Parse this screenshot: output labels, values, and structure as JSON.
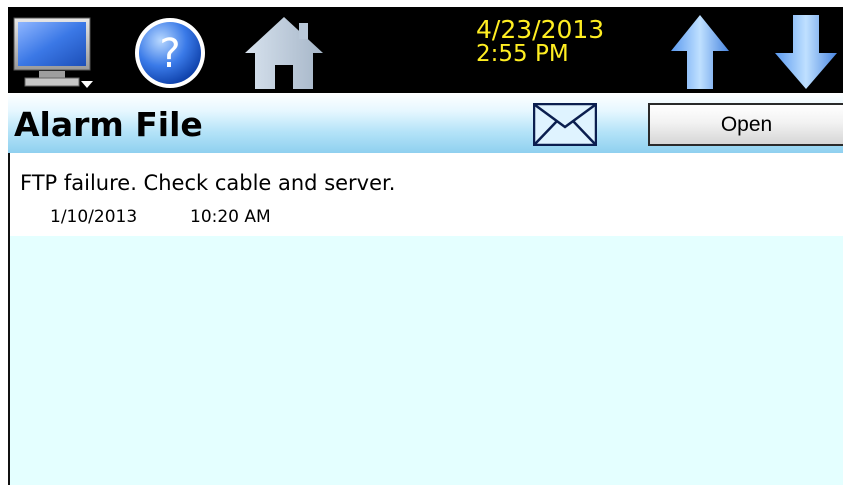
{
  "topbar": {
    "date": "4/23/2013",
    "time": "2:55 PM",
    "date_color": "#ffee22",
    "icons": [
      "monitor-icon",
      "help-icon",
      "home-icon",
      "arrow-up-icon",
      "arrow-down-icon"
    ]
  },
  "header": {
    "title": "Alarm File",
    "mail_icon": "envelope-icon",
    "open_label": "Open"
  },
  "alarms": [
    {
      "message": "FTP failure. Check cable and server.",
      "date": "1/10/2013",
      "time": "10:20 AM"
    }
  ],
  "colors": {
    "content_background": "#e4ffff",
    "header_gradient_bottom": "#8fd0ef",
    "topbar_background": "#000000"
  }
}
